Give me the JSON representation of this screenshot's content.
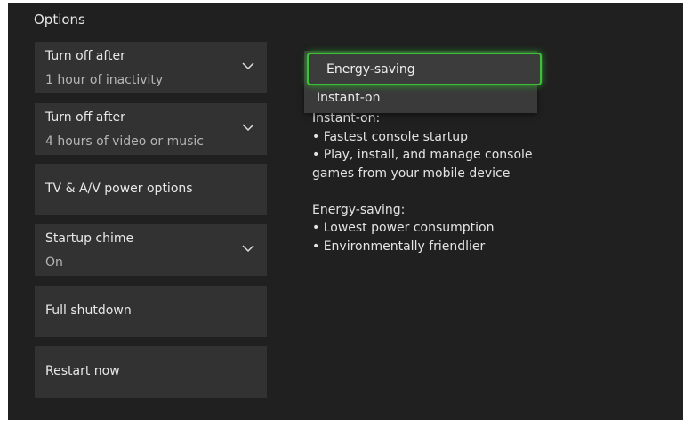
{
  "header": {
    "title": "Options"
  },
  "tiles": [
    {
      "label": "Turn off after",
      "value": "1 hour of inactivity",
      "dropdown": true
    },
    {
      "label": "Turn off after",
      "value": "4 hours of video or music",
      "dropdown": true
    },
    {
      "label": "TV & A/V power options"
    },
    {
      "label": "Startup chime",
      "value": "On",
      "dropdown": true
    },
    {
      "label": "Full shutdown"
    },
    {
      "label": "Restart now"
    }
  ],
  "dropdown": {
    "options": [
      "Energy-saving",
      "Instant-on"
    ],
    "selected": "Energy-saving"
  },
  "description": {
    "text": "Instant-on:\n• Fastest console startup\n• Play, install, and manage console\ngames from your mobile device\n\nEnergy-saving:\n• Lowest power consumption\n• Environmentally friendlier"
  },
  "colors": {
    "accent": "#3fbf3a",
    "panel": "#202020",
    "tile": "#323232"
  }
}
